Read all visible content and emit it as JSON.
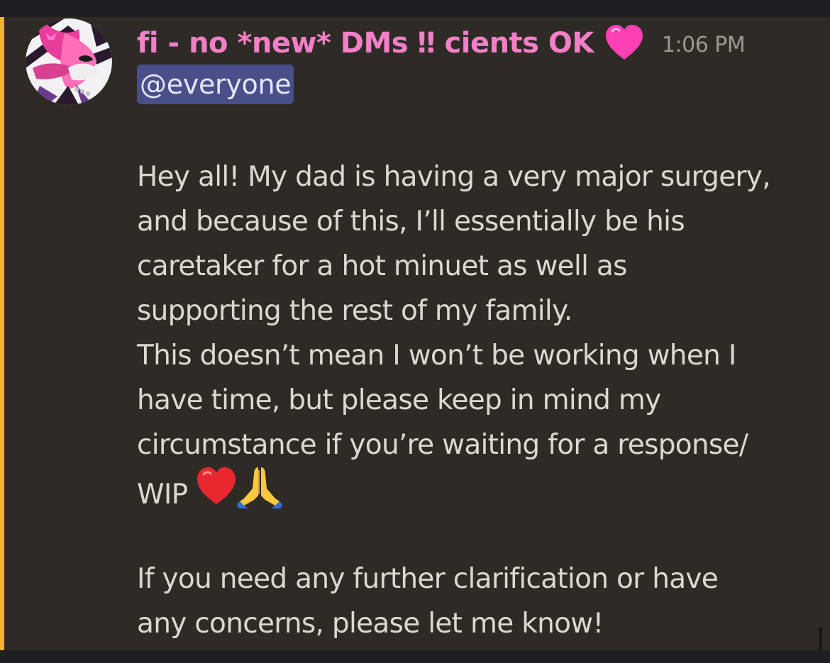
{
  "message": {
    "author": "fi - no *new* DMs ‼ cients OK",
    "author_emoji": "pink-heart",
    "timestamp": "1:06 PM",
    "mention": "@everyone",
    "lines": [
      "Hey all! My dad is having a very major surgery,",
      "and because of this, I’ll essentially be his",
      "caretaker for a hot minuet as well as",
      "supporting the rest of my family.",
      "This doesn’t mean I won’t be working when I",
      "have time, but  please keep in mind my",
      "circumstance if you’re waiting for a response/",
      "WIP",
      "",
      "If you need any further clarification or have",
      "any concerns, please let me know!"
    ],
    "line8_emojis": [
      "red-heart",
      "folded-hands"
    ]
  },
  "colors": {
    "username": "#f47fc8",
    "mention_bg": "#484f89",
    "mention_stripe": "#f0b232",
    "message_bg": "#2e2b26",
    "body_text": "#dcd8d0",
    "timestamp": "#9c9890"
  }
}
